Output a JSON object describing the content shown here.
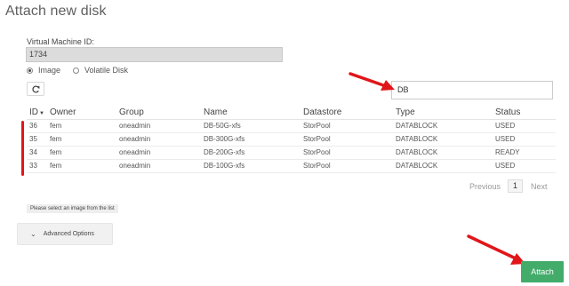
{
  "dialog": {
    "title": "Attach new disk"
  },
  "vm": {
    "label": "Virtual Machine ID:",
    "value": "1734"
  },
  "disk_type": {
    "options": [
      "Image",
      "Volatile Disk"
    ],
    "selected": "Image"
  },
  "toolbar": {
    "refresh_icon": "refresh-icon"
  },
  "search": {
    "value": "DB"
  },
  "table": {
    "columns": [
      "ID",
      "Owner",
      "Group",
      "Name",
      "Datastore",
      "Type",
      "Status"
    ],
    "sort_column": "ID",
    "rows": [
      {
        "id": "36",
        "owner": "fem",
        "group": "oneadmin",
        "name": "DB-50G-xfs",
        "datastore": "StorPool",
        "type": "DATABLOCK",
        "status": "USED"
      },
      {
        "id": "35",
        "owner": "fem",
        "group": "oneadmin",
        "name": "DB-300G-xfs",
        "datastore": "StorPool",
        "type": "DATABLOCK",
        "status": "USED"
      },
      {
        "id": "34",
        "owner": "fem",
        "group": "oneadmin",
        "name": "DB-200G-xfs",
        "datastore": "StorPool",
        "type": "DATABLOCK",
        "status": "READY"
      },
      {
        "id": "33",
        "owner": "fem",
        "group": "oneadmin",
        "name": "DB-100G-xfs",
        "datastore": "StorPool",
        "type": "DATABLOCK",
        "status": "USED"
      }
    ]
  },
  "pagination": {
    "previous": "Previous",
    "page": "1",
    "next": "Next"
  },
  "hint": "Please select an image from the list",
  "advanced": {
    "label": "Advanced Options"
  },
  "actions": {
    "attach": "Attach"
  },
  "colors": {
    "primary": "#43ac6a",
    "annotation": "#e0161a",
    "input_disabled_bg": "#dcdcdc"
  }
}
